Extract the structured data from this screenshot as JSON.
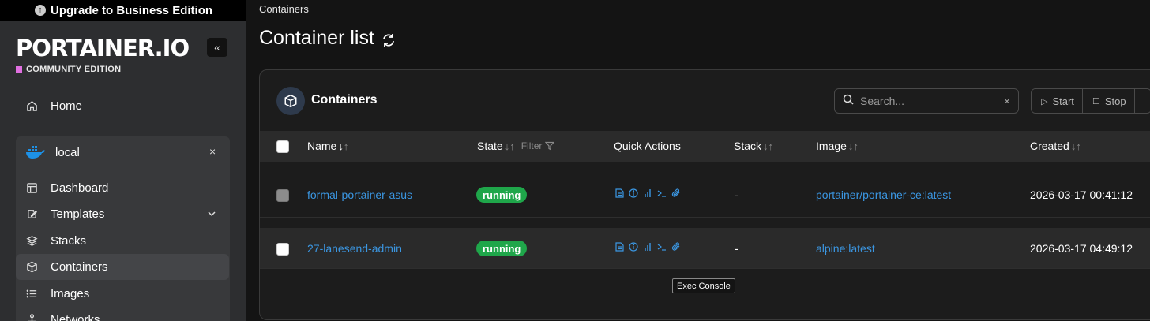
{
  "upgrade": {
    "label": "Upgrade to Business Edition"
  },
  "brand": {
    "logo": "PORTAINER.IO",
    "edition": "COMMUNITY EDITION",
    "collapse_label": "«"
  },
  "sidebar": {
    "home": "Home",
    "environment": {
      "name": "local",
      "close": "×"
    },
    "items": [
      {
        "label": "Dashboard",
        "icon": "dashboard-icon"
      },
      {
        "label": "Templates",
        "icon": "templates-icon"
      },
      {
        "label": "Stacks",
        "icon": "stacks-icon"
      },
      {
        "label": "Containers",
        "icon": "containers-icon"
      },
      {
        "label": "Images",
        "icon": "images-icon"
      },
      {
        "label": "Networks",
        "icon": "networks-icon"
      }
    ]
  },
  "main": {
    "breadcrumb": "Containers",
    "title": "Container list"
  },
  "widget": {
    "title": "Containers",
    "search_placeholder": "Search...",
    "clear": "×",
    "actions": {
      "start": "Start",
      "stop": "Stop"
    },
    "columns": {
      "name": "Name",
      "state": "State",
      "filter": "Filter",
      "quick_actions": "Quick Actions",
      "stack": "Stack",
      "image": "Image",
      "created": "Created"
    },
    "rows": [
      {
        "name": "formal-portainer-asus",
        "state": "running",
        "stack": "-",
        "image": "portainer/portainer-ce:latest",
        "created": "2026-03-17 00:41:12"
      },
      {
        "name": "27-lanesend-admin",
        "state": "running",
        "stack": "-",
        "image": "alpine:latest",
        "created": "2026-03-17 04:49:12"
      }
    ],
    "tooltip": "Exec Console"
  },
  "colors": {
    "accent": "#3b97e3",
    "running": "#1fa64a",
    "brand_pink": "#e070e0"
  }
}
